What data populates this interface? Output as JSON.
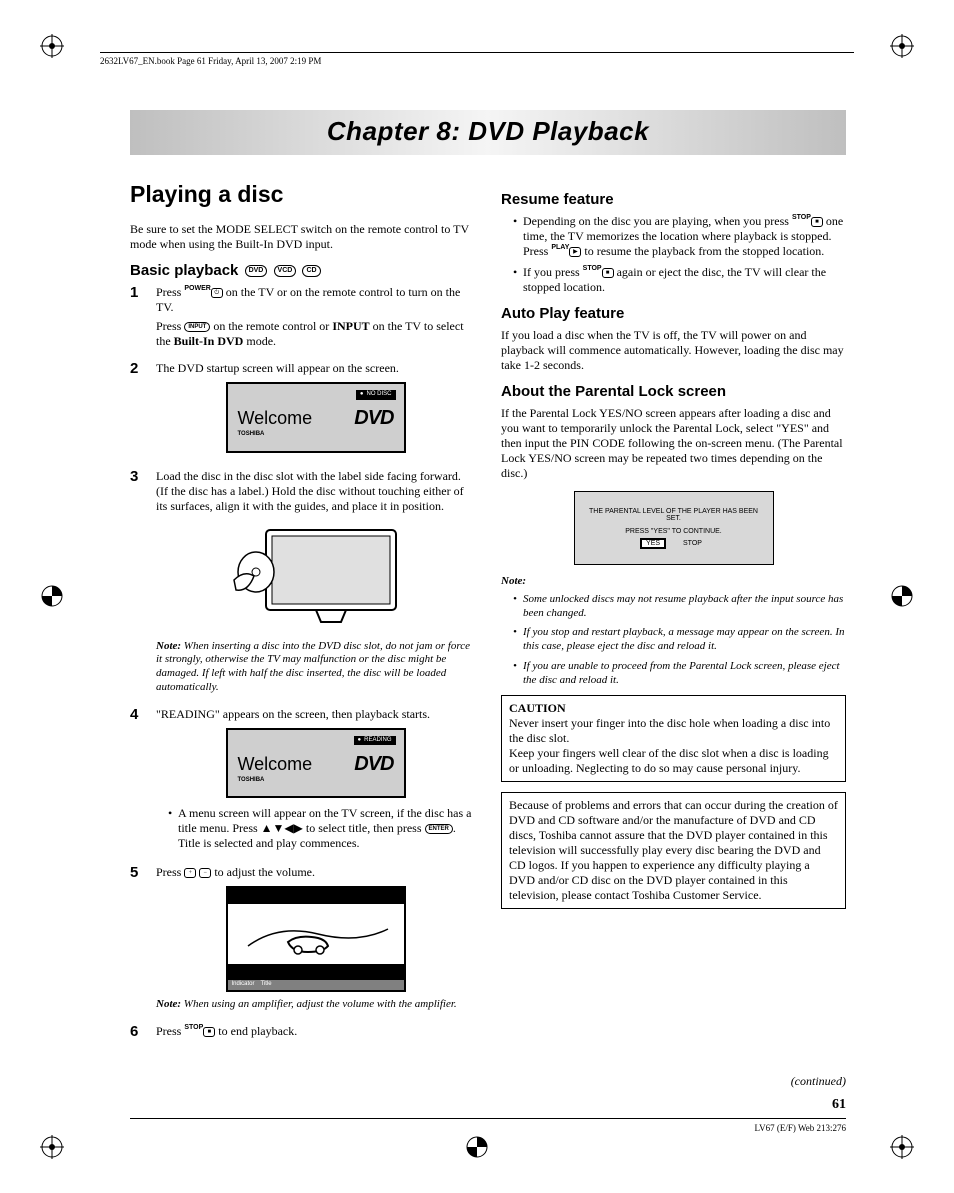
{
  "header_line": "2632LV67_EN.book  Page 61  Friday, April 13, 2007  2:19 PM",
  "chapter_title": "Chapter 8: DVD Playback",
  "left": {
    "section_title": "Playing a disc",
    "intro": "Be sure to set the MODE SELECT switch on the remote control to TV mode when using the Built-In DVD input.",
    "basic_playback_heading": "Basic playback",
    "badges": [
      "DVD",
      "VCD",
      "CD"
    ],
    "steps": [
      {
        "lines": [
          {
            "pre": "Press ",
            "key_top": "POWER",
            "post": " on the TV or on the remote control to turn on the TV."
          },
          {
            "pre": "Press ",
            "key": "INPUT",
            "post_pre": " on the remote  control or ",
            "bold": "INPUT",
            "post": " on the TV to select the ",
            "bold2": "Built-In DVD",
            "post2": " mode."
          }
        ]
      },
      {
        "text": "The DVD startup screen will appear on the screen."
      },
      {
        "text": "Load the disc in the disc slot with the label side facing forward. (If the disc has a label.) Hold the disc without touching either of its surfaces, align it with the guides, and place it in position.",
        "note": "When inserting a disc into the DVD disc slot, do not jam or force it strongly, otherwise the TV may malfunction or the disc might be damaged. If left with half the disc inserted, the disc will be loaded automatically."
      },
      {
        "text": "\"READING\" appears on the screen, then playback starts.",
        "sub_bullet": {
          "pre": "A menu screen will appear on the TV screen, if the disc has a title menu. Press ",
          "arrows": "▲▼◀▶",
          "mid": " to select title, then press ",
          "key": "ENTER",
          "post": ". Title is selected and play commences."
        }
      },
      {
        "pre": "Press ",
        "keys": [
          "+ VOL",
          "VOL -"
        ],
        "post": " to adjust the volume.",
        "note": "When using an amplifier, adjust the volume with the amplifier."
      },
      {
        "pre": "Press ",
        "key_top": "STOP",
        "post": " to end playback."
      }
    ],
    "screen1": {
      "tag": "NO DISC",
      "welcome": "Welcome",
      "logo": "DVD",
      "brand": "TOSHIBA"
    },
    "screen2": {
      "tag": "READING",
      "welcome": "Welcome",
      "logo": "DVD",
      "brand": "TOSHIBA"
    },
    "game_strip": {
      "left": "Indicator",
      "right": "Title"
    },
    "note_label": "Note:"
  },
  "right": {
    "resume_heading": "Resume feature",
    "resume_bullets": [
      {
        "pre": "Depending on the disc you are playing, when you press ",
        "key": "STOP",
        "post": " one time, the TV memorizes the location where playback is stopped. Press ",
        "key2": "PLAY",
        "post2": " to resume the playback from the stopped location."
      },
      {
        "pre": "If you press ",
        "key": "STOP",
        "post": " again or eject the disc, the TV will clear the stopped location."
      }
    ],
    "autoplay_heading": "Auto Play feature",
    "autoplay_text": "If you load a disc when the TV is off, the TV will power on and playback will commence automatically. However, loading the disc may take 1-2 seconds.",
    "parental_heading": "About the Parental Lock screen",
    "parental_text": "If the Parental Lock YES/NO screen appears after loading a disc and  you want to temporarily unlock the Parental Lock, select \"YES\" and then input the PIN CODE following the on-screen menu. (The Parental Lock YES/NO screen may be repeated two times depending on the disc.)",
    "parental_box": {
      "line1": "THE PARENTAL LEVEL OF THE PLAYER HAS BEEN SET.",
      "line2": "PRESS \"YES\" TO CONTINUE.",
      "yes": "YES",
      "stop": "STOP"
    },
    "notes_label": "Note:",
    "notes": [
      "Some unlocked discs may not resume playback after the input source has been changed.",
      "If you stop and restart playback, a message may appear on the screen. In this case, please eject the disc and reload it.",
      "If you are unable to proceed from the Parental Lock screen, please eject the disc and reload it."
    ],
    "caution_head": "CAUTION",
    "caution_text1": "Never insert your finger into the disc hole when loading a disc into the disc slot.",
    "caution_text2": "Keep your fingers well clear of the disc slot when a disc is loading or unloading. Neglecting to do so may cause personal injury.",
    "disclaimer": "Because of problems and errors that can occur during the creation of DVD and CD software and/or the manufacture of DVD and CD discs, Toshiba cannot assure that the DVD player contained in this television will successfully play every disc bearing the DVD and CD logos. If you happen to experience any difficulty playing a DVD and/or CD disc on the DVD player contained in this television, please contact Toshiba Customer Service."
  },
  "continued": "(continued)",
  "page_number": "61",
  "footer": "LV67 (E/F) Web 213:276"
}
